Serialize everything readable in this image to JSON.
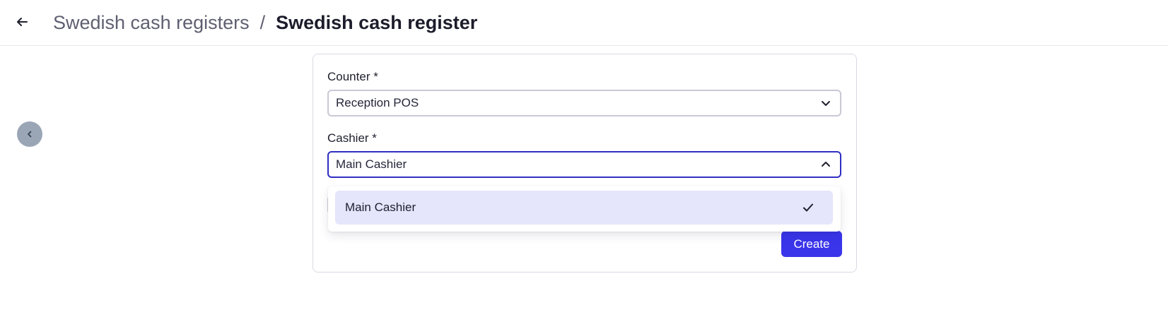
{
  "header": {
    "back_icon": "arrow-left-icon",
    "breadcrumb_parent": "Swedish cash registers",
    "breadcrumb_separator": "/",
    "breadcrumb_current": "Swedish cash register"
  },
  "sidebar_toggle": {
    "icon": "chevron-left-icon"
  },
  "form": {
    "counter_label": "Counter *",
    "counter_value": "Reception POS",
    "cashier_label": "Cashier *",
    "cashier_value": "Main Cashier",
    "create_label": "Create"
  },
  "dropdown": {
    "options": [
      {
        "label": "Main Cashier",
        "selected": true
      }
    ]
  },
  "colors": {
    "accent": "#3a35ea",
    "focus_border": "#2e2ec2",
    "selected_option_bg": "#e5e5fb",
    "toggle_bg": "#9aa6b6"
  }
}
